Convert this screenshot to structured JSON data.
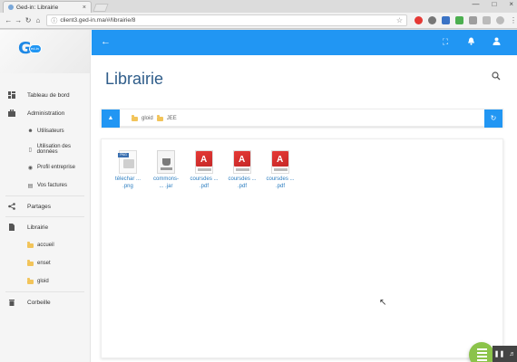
{
  "browser": {
    "tab_title": "Ged-in: Librairie",
    "tab_close": "×",
    "url": "client3.ged-in.ma/#/librairie/8",
    "window_buttons": [
      "—",
      "□",
      "×"
    ],
    "nav_icons": [
      "arrow-left-icon",
      "arrow-right-icon",
      "reload-icon",
      "home-icon"
    ]
  },
  "sidebar": {
    "logo_letter": "G",
    "logo_small": "ed-in",
    "items": [
      {
        "label": "Tableau de bord",
        "icon": "dashboard-icon"
      },
      {
        "label": "Administration",
        "icon": "briefcase-icon"
      },
      {
        "label": "Partages",
        "icon": "share-icon"
      },
      {
        "label": "Librairie",
        "icon": "file-icon"
      },
      {
        "label": "Corbeille",
        "icon": "trash-icon"
      }
    ],
    "admin_sub": [
      {
        "label": "Utilisateurs",
        "icon": "users-icon"
      },
      {
        "label": "Utilisation des données",
        "icon": "data-icon"
      },
      {
        "label": "Profil entreprise",
        "icon": "building-icon"
      },
      {
        "label": "Vos factures",
        "icon": "invoice-icon"
      }
    ],
    "library_sub": [
      {
        "label": "accueil"
      },
      {
        "label": "enset"
      },
      {
        "label": "gloid"
      }
    ]
  },
  "topbar": {
    "icons": [
      "fullscreen-icon",
      "bell-icon",
      "user-icon"
    ]
  },
  "main": {
    "title": "Librairie",
    "breadcrumb": [
      "gloid",
      "JEE"
    ],
    "files": [
      {
        "name1": "télechar ...",
        "name2": ".png",
        "type": "png",
        "badge": "PNG"
      },
      {
        "name1": "commons-",
        "name2": "... .jar",
        "type": "jar"
      },
      {
        "name1": "coursdes ...",
        "name2": ".pdf",
        "type": "pdf"
      },
      {
        "name1": "coursdes ...",
        "name2": ".pdf",
        "type": "pdf"
      },
      {
        "name1": "coursdes ...",
        "name2": ".pdf",
        "type": "pdf"
      }
    ]
  },
  "colors": {
    "accent": "#2196f3",
    "title": "#2f5d8a",
    "fab": "#8bc34a",
    "folder": "#f2c45a"
  }
}
